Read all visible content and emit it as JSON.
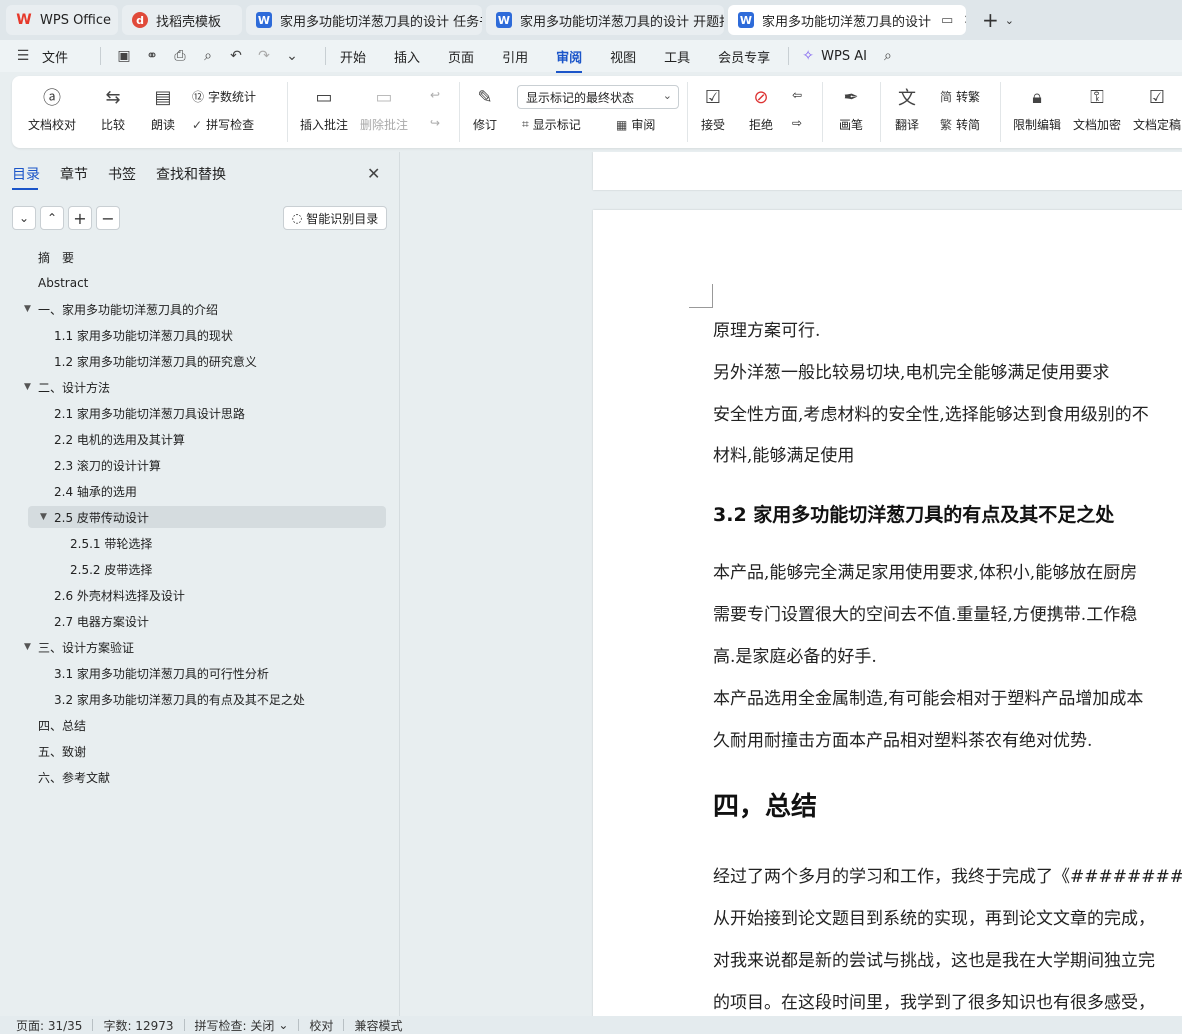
{
  "tabs": [
    {
      "label": "WPS Office",
      "icon": "wps-logo-icon"
    },
    {
      "label": "找稻壳模板",
      "icon": "docer-icon"
    },
    {
      "label": "家用多功能切洋葱刀具的设计 任务书",
      "icon": "word-doc-icon"
    },
    {
      "label": "家用多功能切洋葱刀具的设计 开题报",
      "icon": "word-doc-icon"
    },
    {
      "label": "家用多功能切洋葱刀具的设计",
      "icon": "word-doc-icon"
    }
  ],
  "menu": {
    "file": "文件",
    "items": [
      "开始",
      "插入",
      "页面",
      "引用",
      "审阅",
      "视图",
      "工具",
      "会员专享"
    ],
    "active": "审阅",
    "ai": "WPS AI"
  },
  "ribbon": {
    "proofread": "文档校对",
    "compare": "比较",
    "read_aloud": "朗读",
    "word_count": "字数统计",
    "spell_check": "拼写检查",
    "insert_comment": "插入批注",
    "delete_comment": "删除批注",
    "track_changes": "修订",
    "markup_state": "显示标记的最终状态",
    "show_markup": "显示标记",
    "review": "审阅",
    "accept": "接受",
    "reject": "拒绝",
    "pen": "画笔",
    "translate": "翻译",
    "to_traditional": "转繁",
    "to_simplified": "转简",
    "restrict_edit": "限制编辑",
    "encrypt": "文档加密",
    "finalize": "文档定稿",
    "to_trad_prefix": "简",
    "to_simp_prefix": "繁"
  },
  "panel": {
    "tabs": [
      "目录",
      "章节",
      "书签",
      "查找和替换"
    ],
    "smart_toc": "智能识别目录",
    "toc": [
      {
        "label": "摘　要",
        "level": 1,
        "arrow": false
      },
      {
        "label": "Abstract",
        "level": 1,
        "arrow": false
      },
      {
        "label": "一、家用多功能切洋葱刀具的介绍",
        "level": 1,
        "arrow": true
      },
      {
        "label": "1.1 家用多功能切洋葱刀具的现状",
        "level": 2,
        "arrow": false
      },
      {
        "label": "1.2 家用多功能切洋葱刀具的研究意义",
        "level": 2,
        "arrow": false
      },
      {
        "label": "二、设计方法",
        "level": 1,
        "arrow": true
      },
      {
        "label": "2.1 家用多功能切洋葱刀具设计思路",
        "level": 2,
        "arrow": false
      },
      {
        "label": "2.2 电机的选用及其计算",
        "level": 2,
        "arrow": false
      },
      {
        "label": "2.3 滚刀的设计计算",
        "level": 2,
        "arrow": false
      },
      {
        "label": "2.4 轴承的选用",
        "level": 2,
        "arrow": false
      },
      {
        "label": "2.5 皮带传动设计",
        "level": 2,
        "arrow": true,
        "selected": true
      },
      {
        "label": "2.5.1 带轮选择",
        "level": 3,
        "arrow": false
      },
      {
        "label": "2.5.2 皮带选择",
        "level": 3,
        "arrow": false
      },
      {
        "label": "2.6 外壳材料选择及设计",
        "level": 2,
        "arrow": false
      },
      {
        "label": "2.7 电器方案设计",
        "level": 2,
        "arrow": false
      },
      {
        "label": "三、设计方案验证",
        "level": 1,
        "arrow": true
      },
      {
        "label": "3.1 家用多功能切洋葱刀具的可行性分析",
        "level": 2,
        "arrow": false
      },
      {
        "label": "3.2 家用多功能切洋葱刀具的有点及其不足之处",
        "level": 2,
        "arrow": false
      },
      {
        "label": "四、总结",
        "level": 1,
        "arrow": false
      },
      {
        "label": "五、致谢",
        "level": 1,
        "arrow": false
      },
      {
        "label": "六、参考文献",
        "level": 1,
        "arrow": false
      }
    ]
  },
  "document": {
    "p1": "原理方案可行.",
    "p2": "另外洋葱一般比较易切块,电机完全能够满足使用要求",
    "p3": "安全性方面,考虑材料的安全性,选择能够达到食用级别的不",
    "p4": "材料,能够满足使用",
    "h_3_2": "3.2 家用多功能切洋葱刀具的有点及其不足之处",
    "p5": "本产品,能够完全满足家用使用要求,体积小,能够放在厨房",
    "p6": "需要专门设置很大的空间去不值.重量轻,方便携带.工作稳",
    "p7": "高.是家庭必备的好手.",
    "p8": "本产品选用全金属制造,有可能会相对于塑料产品增加成本",
    "p9": "久耐用耐撞击方面本产品相对塑料茶农有绝对优势.",
    "h_4": "四，总结",
    "p10": "经过了两个多月的学习和工作，我终于完成了《##########",
    "p11": "从开始接到论文题目到系统的实现，再到论文文章的完成，",
    "p12": "对我来说都是新的尝试与挑战，这也是我在大学期间独立完",
    "p13": "的项目。在这段时间里，我学到了很多知识也有很多感受，"
  },
  "status": {
    "page": "页面: 31/35",
    "words": "字数: 12973",
    "spell": "拼写检查: 关闭",
    "proof": "校对",
    "compat": "兼容模式"
  },
  "colors": {
    "accent": "#1b55c9",
    "word_blue": "#2e6bd9",
    "wps_red": "#e6392b"
  }
}
